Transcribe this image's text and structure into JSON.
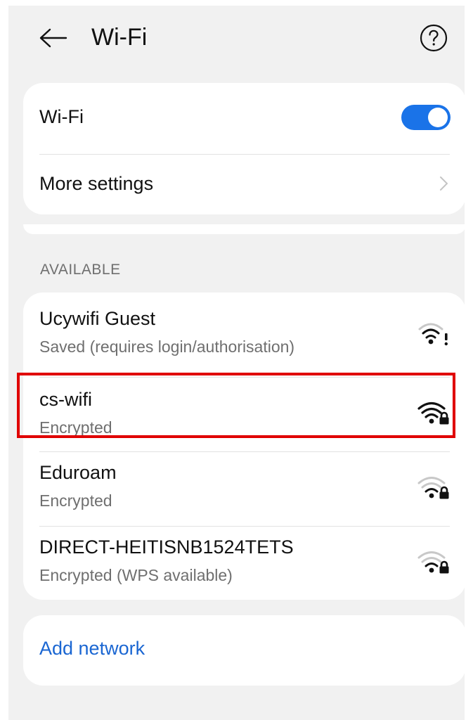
{
  "header": {
    "title": "Wi-Fi",
    "back_icon": "arrow-left-icon",
    "help_icon": "question-circle-icon"
  },
  "settings": {
    "wifi_label": "Wi-Fi",
    "wifi_enabled": true,
    "more_settings_label": "More settings"
  },
  "available": {
    "section_label": "AVAILABLE",
    "networks": [
      {
        "name": "Ucywifi Guest",
        "status": "Saved (requires login/authorisation)",
        "icon": "wifi-alert-icon",
        "signal": "medium",
        "highlighted": false
      },
      {
        "name": "cs-wifi",
        "status": "Encrypted",
        "icon": "wifi-lock-icon",
        "signal": "full",
        "highlighted": true
      },
      {
        "name": "Eduroam",
        "status": "Encrypted",
        "icon": "wifi-lock-icon",
        "signal": "medium",
        "highlighted": false
      },
      {
        "name": "DIRECT-HEITISNB1524TETS",
        "status": "Encrypted (WPS available)",
        "icon": "wifi-lock-icon",
        "signal": "low",
        "highlighted": false
      }
    ]
  },
  "add_network": {
    "label": "Add network"
  },
  "colors": {
    "accent": "#1a73e8",
    "link": "#1a66d2",
    "highlight": "#e00000",
    "background": "#f1f1f1"
  }
}
